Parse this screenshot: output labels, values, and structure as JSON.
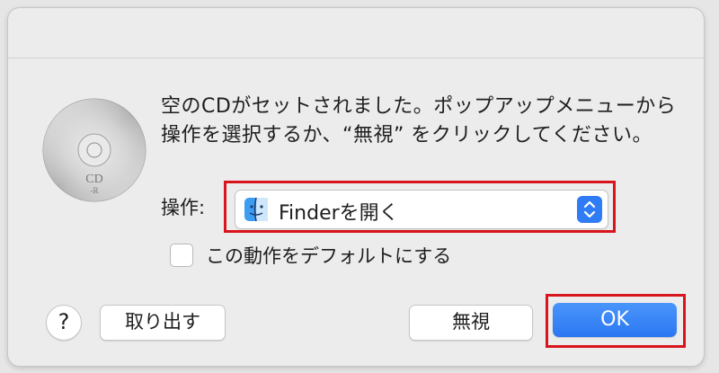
{
  "dialog": {
    "message": "空のCDがセットされました。ポップアップメニューから操作を選択するか、“無視” をクリックしてください。",
    "action_label": "操作:",
    "action_select": {
      "value": "Finderを開く"
    },
    "default_checkbox": {
      "label": "この動作をデフォルトにする",
      "checked": false
    },
    "help_label": "?",
    "eject_label": "取り出す",
    "ignore_label": "無視",
    "ok_label": "OK",
    "cd_icon": {
      "name": "cd-r-icon",
      "text": "CD",
      "subtext": "-R"
    }
  },
  "colors": {
    "accent": "#2f7cf6",
    "highlight": "#d8151d"
  }
}
